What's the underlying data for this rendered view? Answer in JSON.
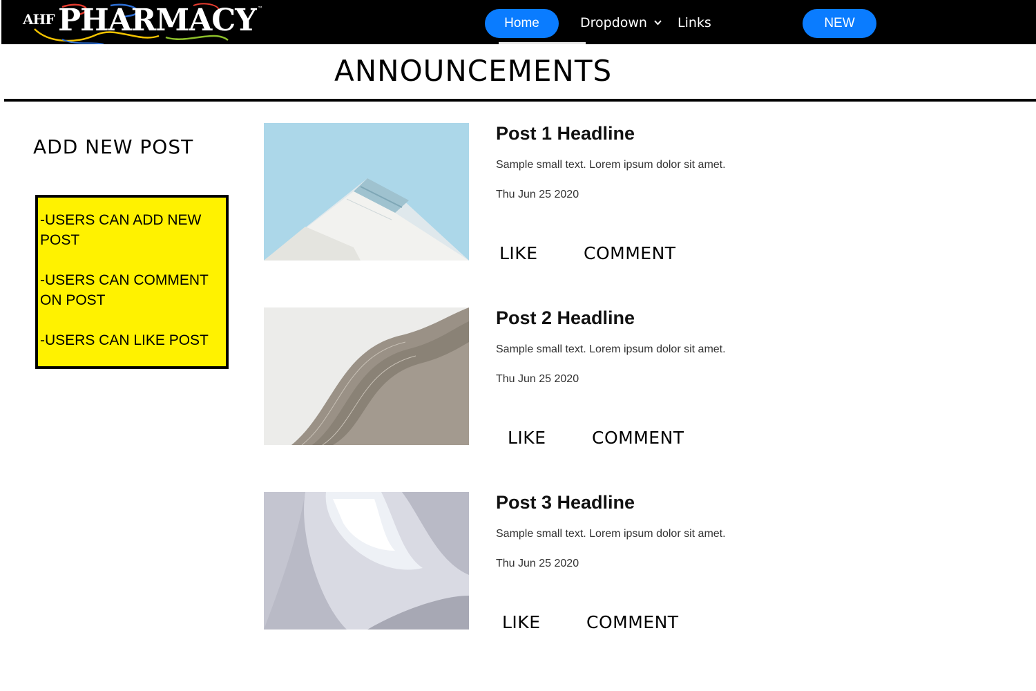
{
  "header": {
    "logo_prefix": "AHF",
    "logo_name": "PHARMACY",
    "logo_tm": "™",
    "nav_home": "Home",
    "nav_dropdown": "Dropdown",
    "nav_dropdown_icon": "chevron-down-icon",
    "nav_links": "Links",
    "nav_new": "NEW"
  },
  "page": {
    "title": "ANNOUNCEMENTS"
  },
  "sidebar": {
    "add_post_label": "ADD NEW POST",
    "notes": [
      "-USERS CAN ADD NEW POST",
      "-USERS CAN COMMENT ON POST",
      "-USERS CAN LIKE POST"
    ]
  },
  "posts": [
    {
      "headline": "Post 1 Headline",
      "snippet": "Sample small text. Lorem ipsum dolor sit amet.",
      "date": "Thu Jun 25 2020",
      "like_label": "LIKE",
      "comment_label": "COMMENT"
    },
    {
      "headline": "Post 2 Headline",
      "snippet": "Sample small text. Lorem ipsum dolor sit amet.",
      "date": "Thu Jun 25 2020",
      "like_label": "LIKE",
      "comment_label": "COMMENT"
    },
    {
      "headline": "Post 3 Headline",
      "snippet": "Sample small text. Lorem ipsum dolor sit amet.",
      "date": "Thu Jun 25 2020",
      "like_label": "LIKE",
      "comment_label": "COMMENT"
    }
  ],
  "colors": {
    "nav_background": "#000000",
    "accent_button": "#0a7cff",
    "note_background": "#fff200"
  }
}
